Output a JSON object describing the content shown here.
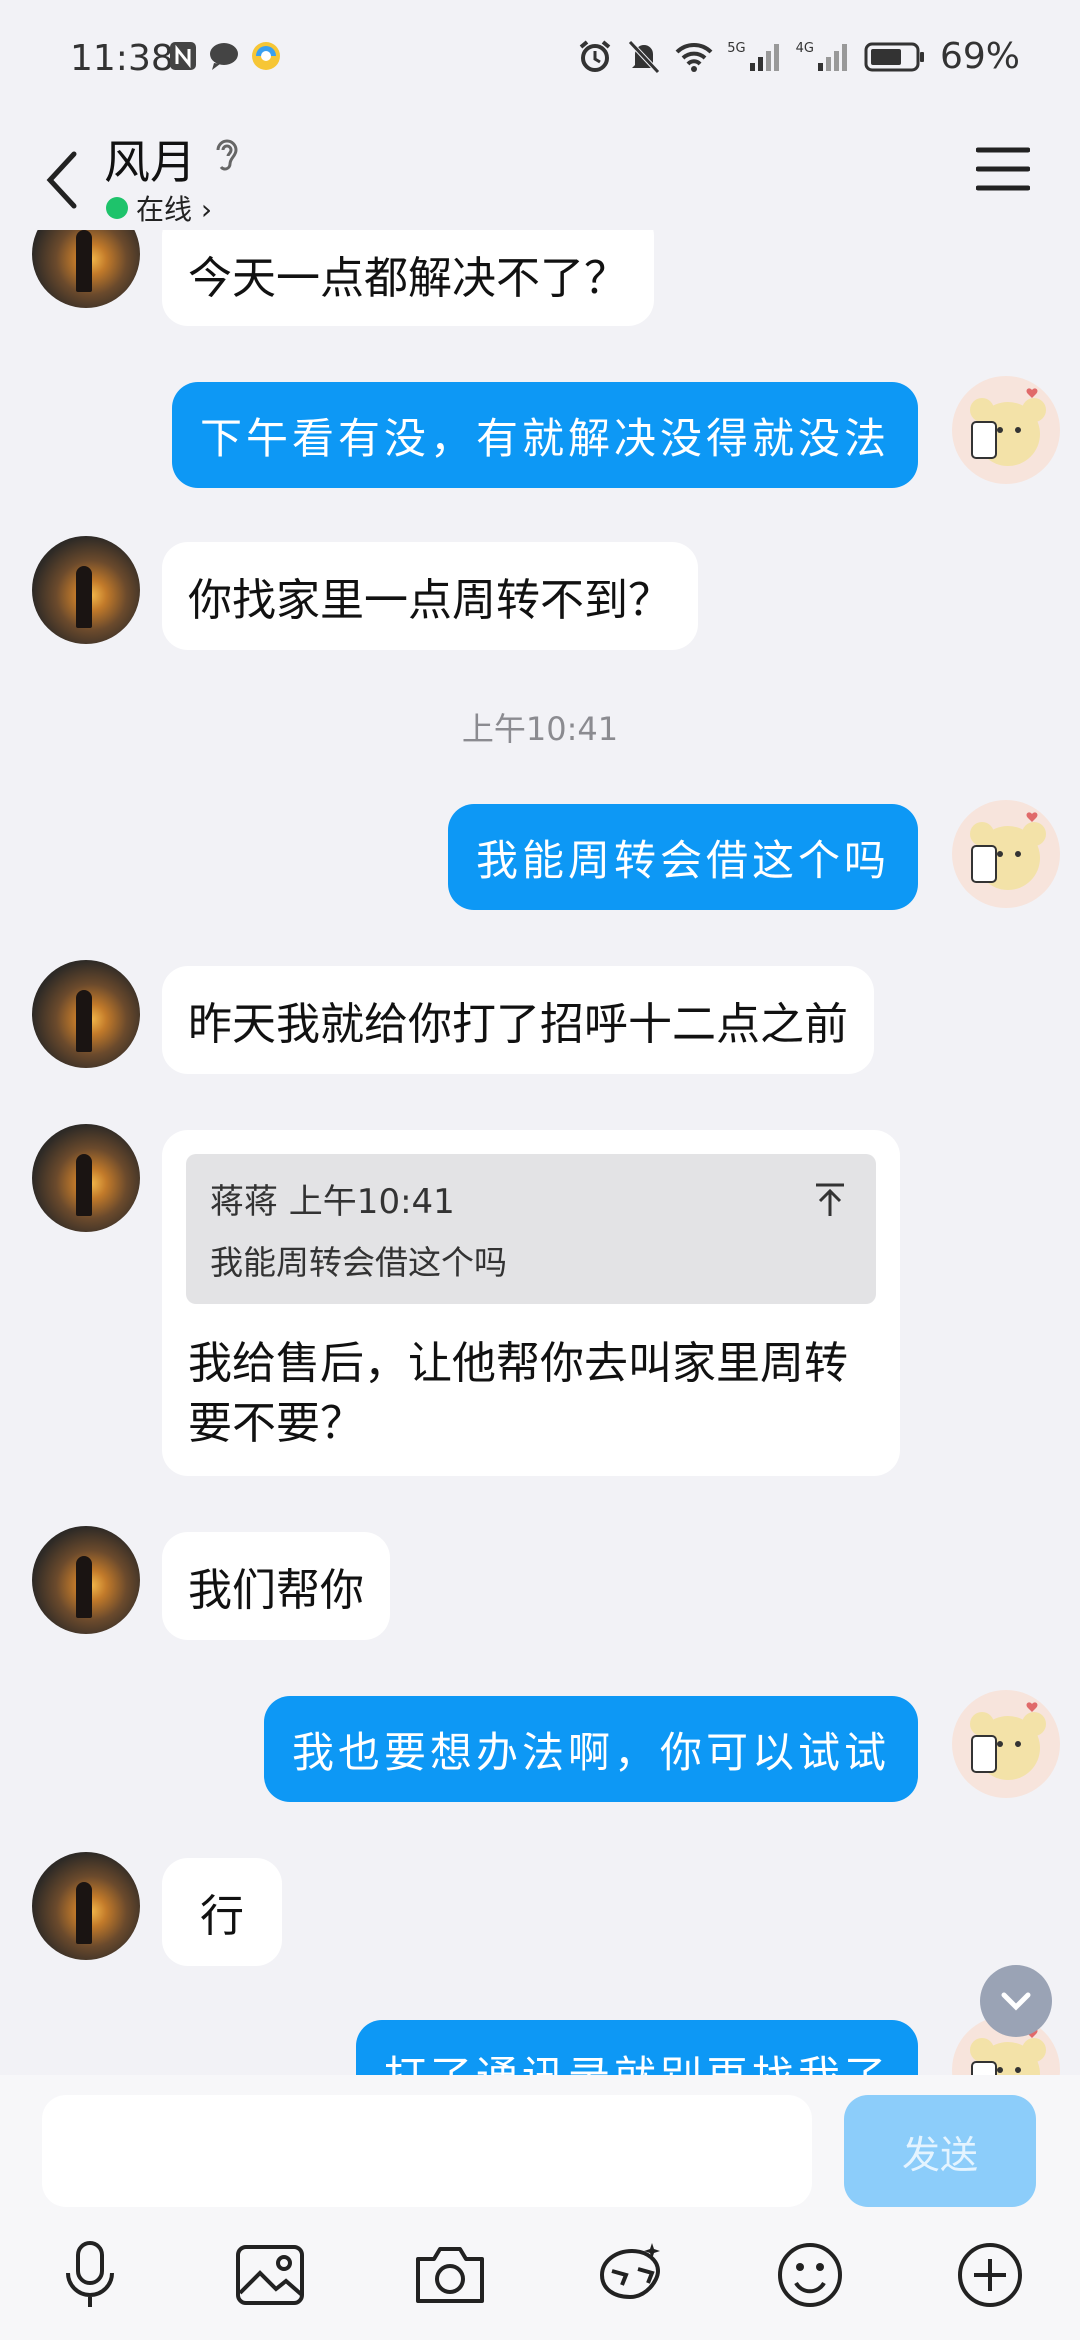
{
  "status_bar": {
    "time": "11:38",
    "battery": "69%",
    "network_1": "5G",
    "network_2": "4G"
  },
  "header": {
    "contact_name": "风月",
    "status": "在线 ›"
  },
  "messages": [
    {
      "side": "in",
      "text": "今天一点都解决不了？"
    },
    {
      "side": "out",
      "text": "下午看有没，有就解决没得就没法"
    },
    {
      "side": "in",
      "text": "你找家里一点周转不到？"
    },
    {
      "side": "time",
      "text": "上午10:41"
    },
    {
      "side": "out",
      "text": "我能周转会借这个吗"
    },
    {
      "side": "in",
      "text": "昨天我就给你打了招呼十二点之前"
    },
    {
      "side": "quote",
      "quote_meta": "蒋蒋 上午10:41",
      "quote_text": "我能周转会借这个吗",
      "text": "我给售后，让他帮你去叫家里周转要不要？"
    },
    {
      "side": "in",
      "text": "我们帮你"
    },
    {
      "side": "out",
      "text": "我也要想办法啊，你可以试试"
    },
    {
      "side": "in",
      "text": "行"
    },
    {
      "side": "out",
      "text": "打了通讯录就别再找我了"
    }
  ],
  "input": {
    "placeholder": "",
    "send_label": "发送"
  },
  "toolbar": [
    "microphone-icon",
    "image-icon",
    "camera-icon",
    "red-packet-icon",
    "emoji-icon",
    "plus-icon"
  ],
  "colors": {
    "out_bubble": "#0d98f5",
    "in_bubble": "#ffffff",
    "background": "#f2f2f6",
    "send_button": "#8ccdfa",
    "online": "#1ec36b"
  }
}
